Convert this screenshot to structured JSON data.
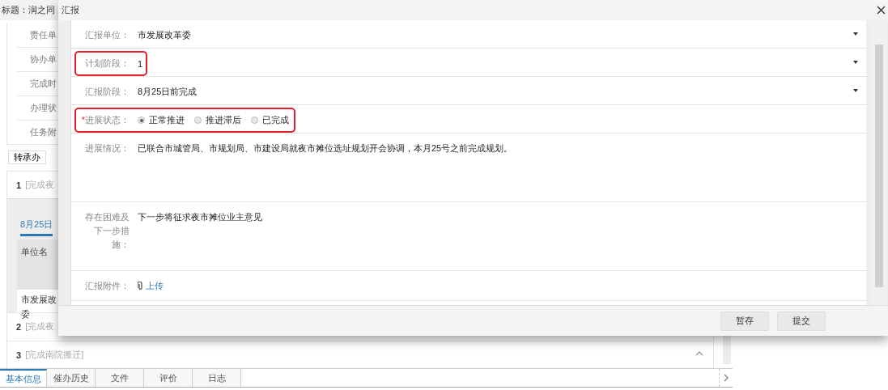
{
  "background": {
    "title": "标题：润之同",
    "info_labels": [
      "责任单",
      "协办单",
      "完成时",
      "办理状",
      "任务附"
    ],
    "transfer_button": "转承办",
    "stages": [
      {
        "number": "1",
        "name": "[完成夜",
        "expanded": true
      },
      {
        "number": "2",
        "name": "[完成夜",
        "expanded": false
      },
      {
        "number": "3",
        "name": "[完成南院搬迁]",
        "expanded": false
      }
    ],
    "stage_tab": "8月25日",
    "table": {
      "columns": [
        "单位名"
      ],
      "rows": [
        [
          "市发展改委"
        ]
      ]
    },
    "bottom_tabs": [
      {
        "label": "基本信息",
        "selected": true
      },
      {
        "label": "催办历史",
        "selected": false
      },
      {
        "label": "文件",
        "selected": false
      },
      {
        "label": "评价",
        "selected": false
      },
      {
        "label": "日志",
        "selected": false
      }
    ]
  },
  "dialog": {
    "title": "汇报",
    "fields": [
      {
        "kind": "select",
        "label": "汇报单位：",
        "value": "市发展改革委",
        "highlighted": false
      },
      {
        "kind": "select",
        "label": "计划阶段：",
        "value": "1",
        "highlighted": true
      },
      {
        "kind": "select",
        "label": "汇报阶段：",
        "value": "8月25日前完成",
        "highlighted": false
      },
      {
        "kind": "radio",
        "label": "进展状态：",
        "required_mark": "*",
        "highlighted": true,
        "options": [
          {
            "label": "正常推进",
            "selected": true
          },
          {
            "label": "推进滞后",
            "selected": false
          },
          {
            "label": "已完成",
            "selected": false
          }
        ]
      },
      {
        "kind": "text",
        "label": "进展情况：",
        "value": "已联合市城管局、市规划局、市建设局就夜市摊位选址规划开会协调，本月25号之前完成规划。",
        "highlighted": false
      },
      {
        "kind": "text",
        "label": "存在困难及下一步措施：",
        "value": "下一步将征求夜市摊位业主意见",
        "highlighted": false
      },
      {
        "kind": "upload",
        "label": "汇报附件：",
        "value": "上传",
        "highlighted": false
      }
    ],
    "buttons": [
      "暂存",
      "提交"
    ]
  }
}
